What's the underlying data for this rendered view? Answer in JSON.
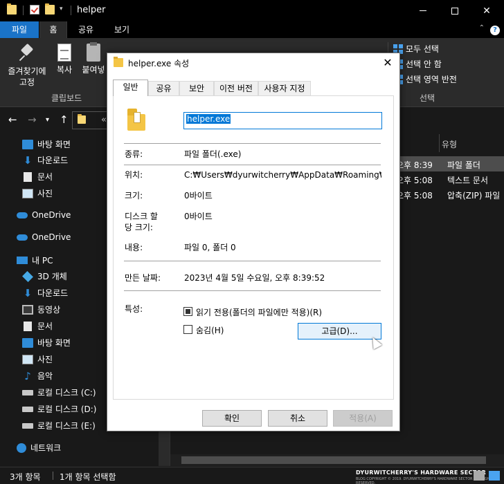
{
  "window": {
    "title": "helper",
    "ribbon_tabs": [
      "파일",
      "홈",
      "공유",
      "보기"
    ],
    "ribbon": {
      "pin_label_1": "즐겨찾기에",
      "pin_label_2": "고정",
      "copy": "복사",
      "paste": "붙여넣",
      "clipboard_group": "클립보드",
      "select_all": "모두 선택",
      "select_none": "선택 안 함",
      "invert_selection": "선택 영역 반전",
      "select_group": "선택"
    },
    "address_text": "« u"
  },
  "sidebar": {
    "items": [
      {
        "label": "바탕 화면",
        "icon": "desktop-icon"
      },
      {
        "label": "다운로드",
        "icon": "download-icon"
      },
      {
        "label": "문서",
        "icon": "documents-icon"
      },
      {
        "label": "사진",
        "icon": "pictures-icon"
      },
      {
        "label": "OneDrive",
        "icon": "onedrive-icon"
      },
      {
        "label": "OneDrive",
        "icon": "onedrive-icon"
      },
      {
        "label": "내 PC",
        "icon": "this-pc-icon"
      },
      {
        "label": "3D 개체",
        "icon": "3d-objects-icon"
      },
      {
        "label": "다운로드",
        "icon": "download-icon"
      },
      {
        "label": "동영상",
        "icon": "videos-icon"
      },
      {
        "label": "문서",
        "icon": "documents-icon"
      },
      {
        "label": "바탕 화면",
        "icon": "desktop-icon"
      },
      {
        "label": "사진",
        "icon": "pictures-icon"
      },
      {
        "label": "음악",
        "icon": "music-icon"
      },
      {
        "label": "로컬 디스크 (C:)",
        "icon": "drive-icon"
      },
      {
        "label": "로컬 디스크 (D:)",
        "icon": "drive-icon"
      },
      {
        "label": "로컬 디스크 (E:)",
        "icon": "drive-icon"
      },
      {
        "label": "네트워크",
        "icon": "network-icon"
      }
    ]
  },
  "filelist": {
    "type_header": "유형",
    "rows": [
      {
        "date": "오후 8:39",
        "type": "파일 폴더",
        "selected": true
      },
      {
        "date": "오후 5:08",
        "type": "텍스트 문서",
        "selected": false
      },
      {
        "date": "오후 5:08",
        "type": "압축(ZIP) 파일",
        "selected": false
      }
    ]
  },
  "status": {
    "count": "3개 항목",
    "selected": "1개 항목 선택함",
    "watermark": "DYURWITCHERRY'S HARDWARE SECTOR",
    "watermark_sub": "BLOG COPYRIGHT © 2019. DYURWITCHERRY'S HARDWARE SECTOR ALL RIGHTS RESERVED."
  },
  "dialog": {
    "title": "helper.exe 속성",
    "tabs": [
      "일반",
      "공유",
      "보안",
      "이전 버전",
      "사용자 지정"
    ],
    "name_value": "helper.exe",
    "type_label": "종류:",
    "type_value": "파일 폴더(.exe)",
    "location_label": "위치:",
    "location_value": "C:₩Users₩dyurwitcherry₩AppData₩Roaming₩uTorre",
    "size_label": "크기:",
    "size_value": "0바이트",
    "disk_size_label_1": "디스크 할",
    "disk_size_label_2": "당 크기:",
    "disk_size_value": "0바이트",
    "contents_label": "내용:",
    "contents_value": "파일 0, 폴더 0",
    "created_label": "만든 날짜:",
    "created_value": "2023년 4월 5일 수요일, 오후 8:39:52",
    "attributes_label": "특성:",
    "readonly_label": "읽기 전용(폴더의 파일에만 적용)(R)",
    "hidden_label": "숨김(H)",
    "advanced_button": "고급(D)...",
    "ok_button": "확인",
    "cancel_button": "취소",
    "apply_button": "적용(A)"
  },
  "colors": {
    "accent": "#1a73c8",
    "dark_bg": "#191919",
    "dialog_bg": "#ffffff",
    "selection": "#0078d7"
  }
}
